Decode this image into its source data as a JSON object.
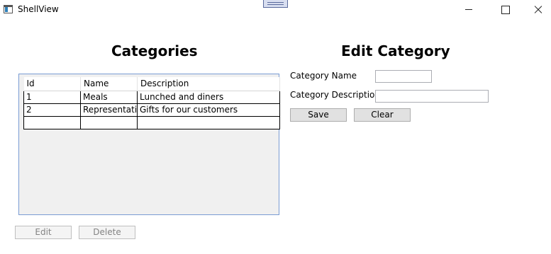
{
  "window": {
    "title": "ShellView",
    "icons": {
      "app": "app-window-icon",
      "minimize": "minimize-icon",
      "maximize": "maximize-icon",
      "close": "close-icon"
    }
  },
  "categories_panel": {
    "heading": "Categories",
    "columns": [
      "Id",
      "Name",
      "Description"
    ],
    "rows": [
      [
        "1",
        "Meals",
        "Lunched and diners"
      ],
      [
        "2",
        "Representati",
        "Gifts for our customers"
      ]
    ],
    "edit_label": "Edit",
    "delete_label": "Delete"
  },
  "edit_panel": {
    "heading": "Edit Category",
    "name_label": "Category Name",
    "name_value": "",
    "description_label": "Category Description",
    "description_value": "",
    "save_label": "Save",
    "clear_label": "Clear"
  },
  "colors": {
    "grid_border": "#7a9cd3",
    "grid_background": "#f0f0f0",
    "button_face": "#e1e1e1",
    "disabled_text": "#838383"
  }
}
